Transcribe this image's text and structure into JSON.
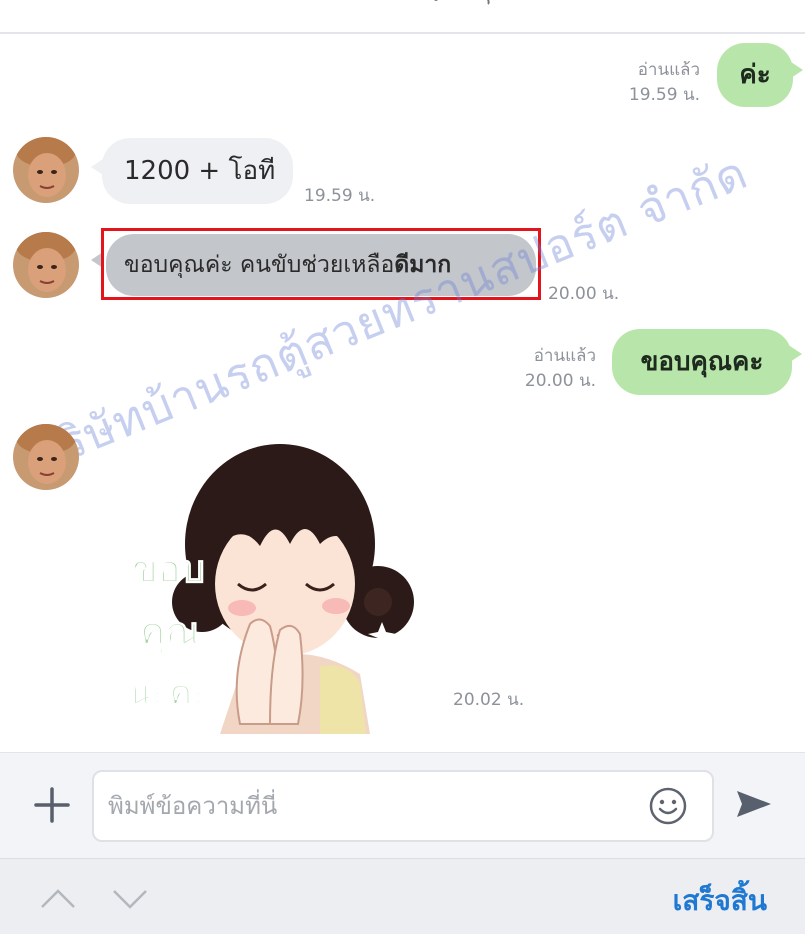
{
  "messages": [
    {
      "direction": "out",
      "text": "ค่ะ",
      "status": "อ่านแล้ว",
      "time": "19.59 น."
    },
    {
      "direction": "in",
      "text": "1200 + โอที",
      "time": "19.59 น."
    },
    {
      "direction": "in",
      "text_normal": "ขอบคุณค่ะ คนขับช่วยเหลือ",
      "text_bold": "ดีมาก",
      "time": "20.00 น.",
      "highlighted": true
    },
    {
      "direction": "out",
      "text": "ขอบคุณคะ",
      "status": "อ่านแล้ว",
      "time": "20.00 น."
    },
    {
      "direction": "in",
      "type": "sticker",
      "sticker_text": [
        "ขอบ",
        "คุณ",
        "นะคะ"
      ],
      "time": "20.02 น."
    }
  ],
  "watermark": "บริษัทบ้านรถตู้สวยทรานสปอร์ต จำกัด",
  "input": {
    "placeholder": "พิมพ์ข้อความที่นี่",
    "value": ""
  },
  "bottom": {
    "done_label": "เสร็จสิ้น"
  },
  "icons": {
    "plus": "plus-icon",
    "emoji": "smiley-icon",
    "send": "send-arrow-icon",
    "up": "chevron-up-icon",
    "down": "chevron-down-icon"
  },
  "colors": {
    "outgoing_bubble": "#b8e6aa",
    "incoming_bubble": "#eef0f3",
    "highlight": "#e3141b",
    "accent": "#1f78d1"
  }
}
